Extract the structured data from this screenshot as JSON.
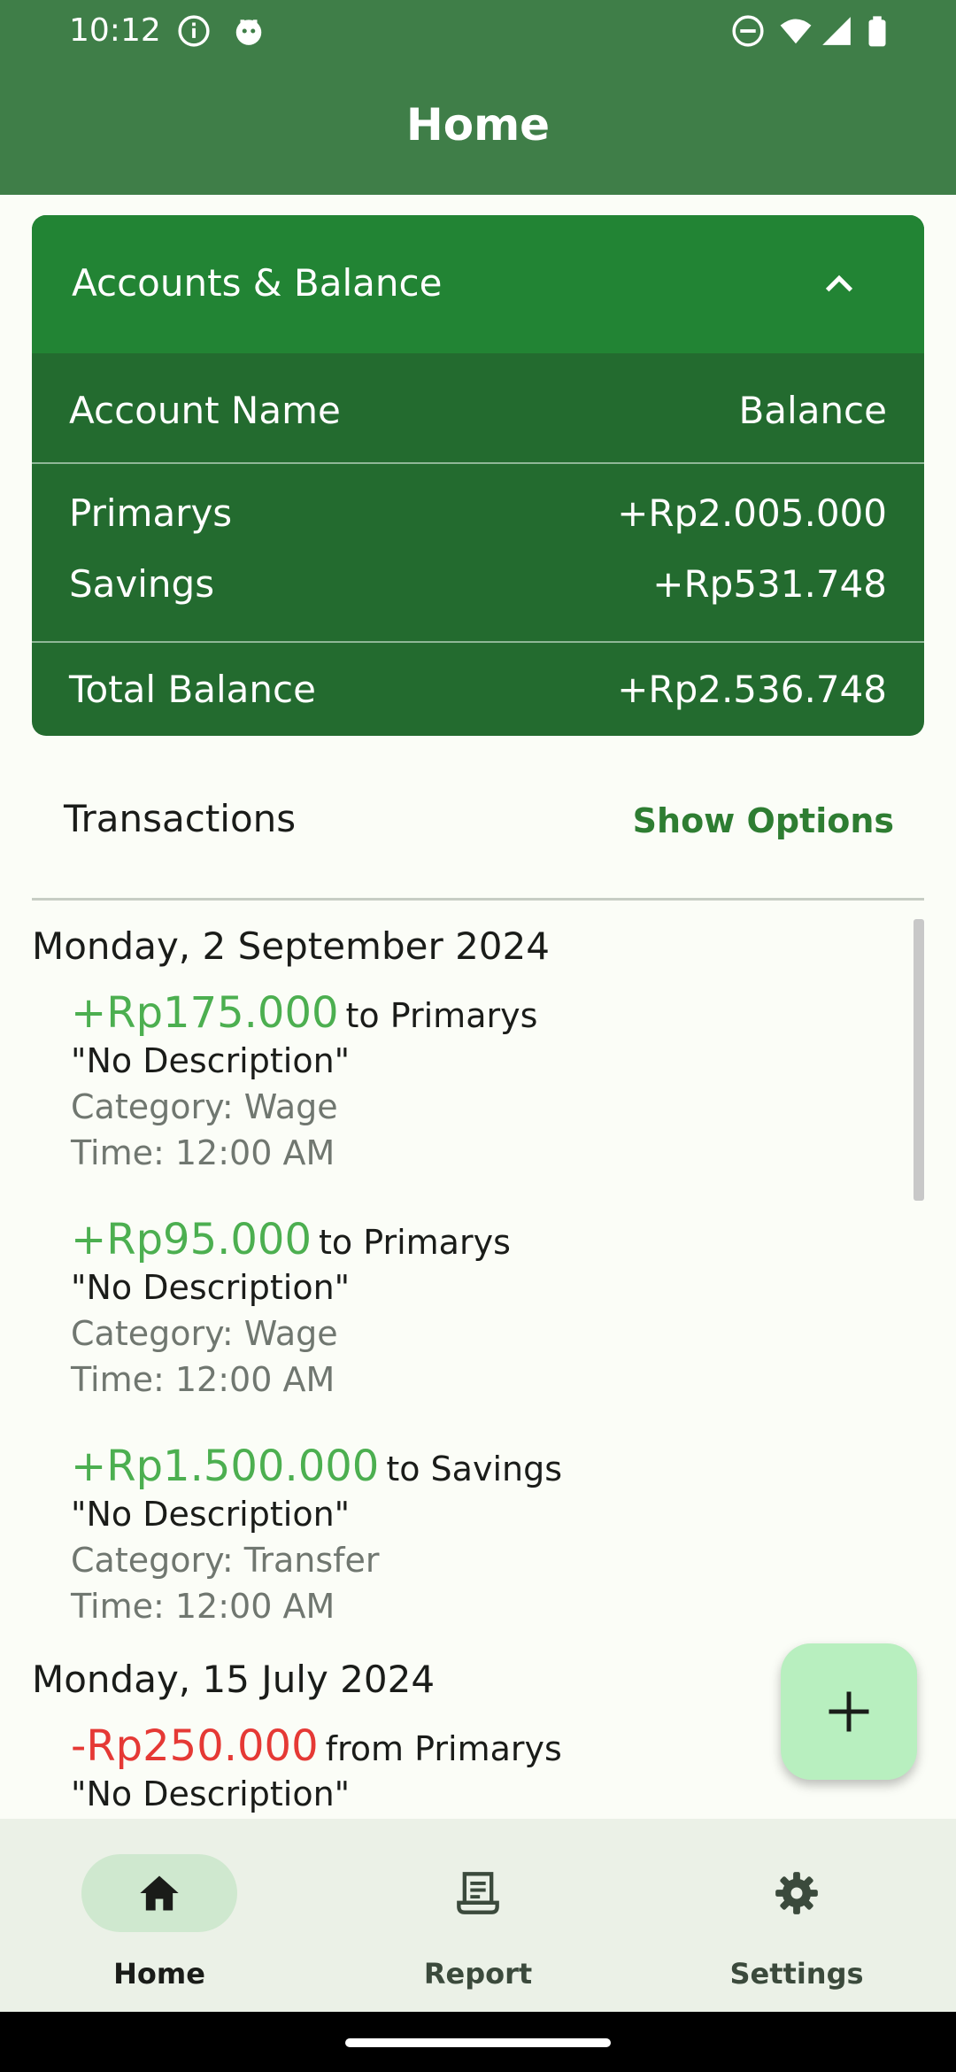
{
  "status": {
    "time": "10:12"
  },
  "appbar": {
    "title": "Home"
  },
  "accounts": {
    "header": "Accounts & Balance",
    "col_name": "Account Name",
    "col_balance": "Balance",
    "rows": [
      {
        "name": "Primarys",
        "balance": "+Rp2.005.000"
      },
      {
        "name": "Savings",
        "balance": "+Rp531.748"
      }
    ],
    "total_label": "Total Balance",
    "total_value": "+Rp2.536.748"
  },
  "transactions": {
    "title": "Transactions",
    "show_options": "Show Options",
    "groups": [
      {
        "date": "Monday, 2 September 2024",
        "items": [
          {
            "amount": "+Rp175.000",
            "account": "to Primarys",
            "description": "\"No Description\"",
            "category": "Category: Wage",
            "time": "Time: 12:00 AM"
          },
          {
            "amount": "+Rp95.000",
            "account": "to Primarys",
            "description": "\"No Description\"",
            "category": "Category: Wage",
            "time": "Time: 12:00 AM"
          },
          {
            "amount": "+Rp1.500.000",
            "account": "to Savings",
            "description": "\"No Description\"",
            "category": "Category: Transfer",
            "time": "Time: 12:00 AM"
          }
        ]
      },
      {
        "date": "Monday, 15 July 2024",
        "items": [
          {
            "amount": "-Rp250.000",
            "account": "from Primarys",
            "description": "\"No Description\""
          }
        ]
      }
    ]
  },
  "fab": {
    "icon": "plus-icon"
  },
  "nav": {
    "items": [
      {
        "label": "Home",
        "icon": "home-icon",
        "active": true
      },
      {
        "label": "Report",
        "icon": "report-icon",
        "active": false
      },
      {
        "label": "Settings",
        "icon": "gear-icon",
        "active": false
      }
    ]
  },
  "colors": {
    "appbar": "#3f7e48",
    "card_header": "#228434",
    "card_body": "#236b2f",
    "income": "#4caf50",
    "expense": "#e53935",
    "accent": "#2e7d32",
    "fab": "#b8efbf"
  }
}
